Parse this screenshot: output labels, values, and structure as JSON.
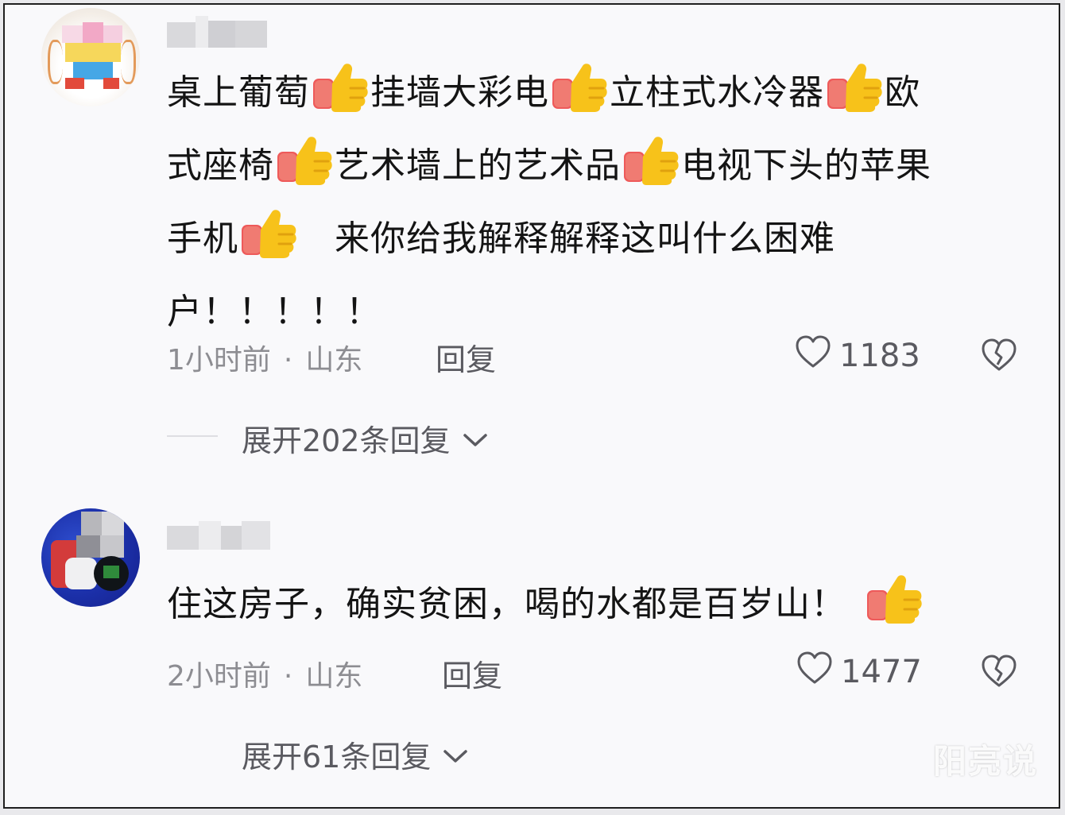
{
  "comments": [
    {
      "text_lines": [
        [
          "桌上葡萄",
          "挂墙大彩电",
          "立柱式水冷器",
          "欧"
        ],
        [
          "式座椅",
          "艺术墙上的艺术品",
          "电视下头的苹果"
        ],
        [
          "手机",
          "　来你给我解释解释这叫什么困难"
        ],
        [
          "户！！！！！"
        ]
      ],
      "time": "1小时前",
      "location": "山东",
      "reply_label": "回复",
      "likes": "1183",
      "expand_label": "展开202条回复"
    },
    {
      "text": "住这房子，确实贫困，喝的水都是百岁山！",
      "time": "2小时前",
      "location": "山东",
      "reply_label": "回复",
      "likes": "1477",
      "expand_label": "展开61条回复"
    }
  ],
  "watermark": "阳亮说",
  "icons": {
    "like": "heart-outline-icon",
    "dislike": "broken-heart-icon",
    "expand": "chevron-down-icon",
    "emoji": "thumbs-up-icon"
  }
}
